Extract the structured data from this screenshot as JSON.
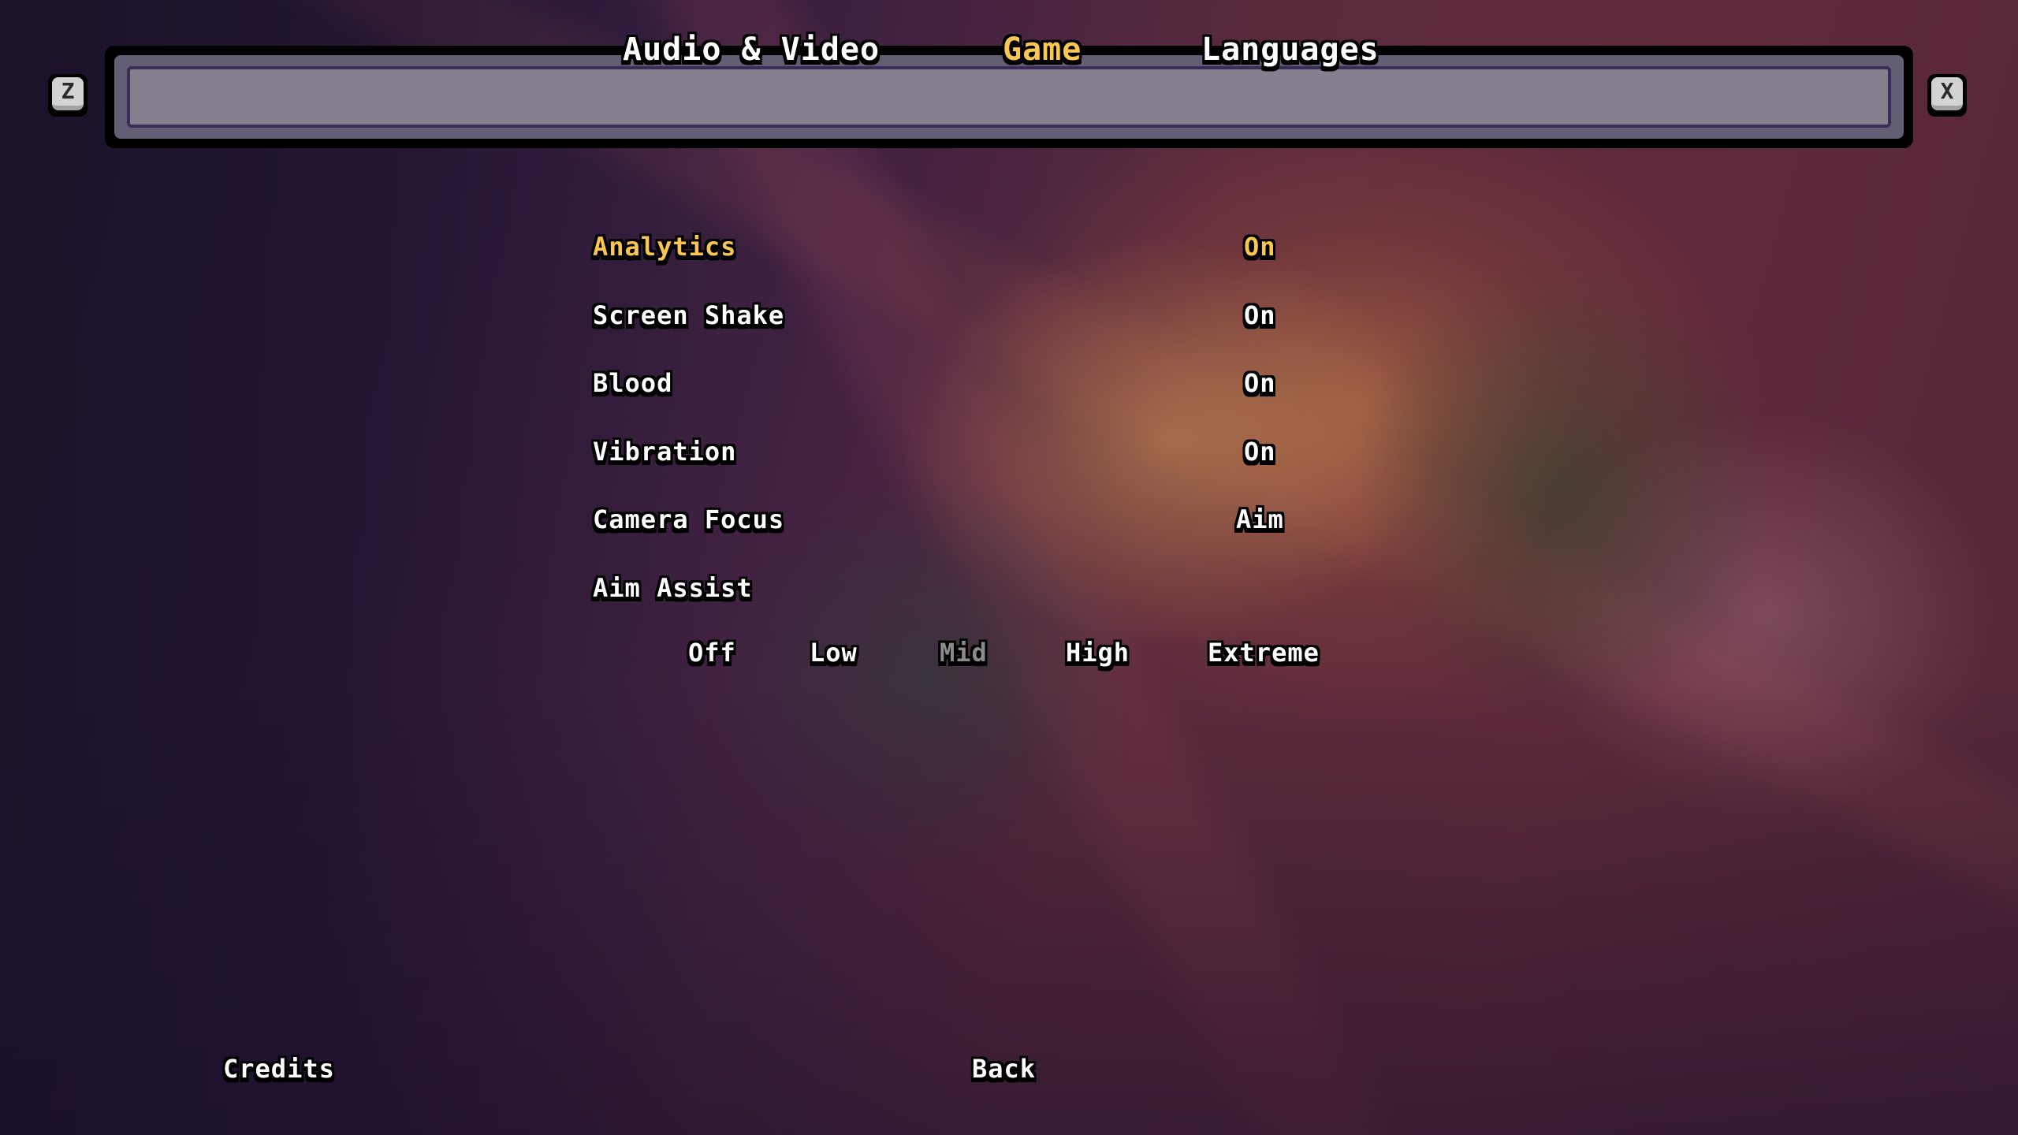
{
  "tabs": [
    {
      "label": "Audio & Video",
      "selected": false
    },
    {
      "label": "Game",
      "selected": true
    },
    {
      "label": "Languages",
      "selected": false
    }
  ],
  "keys": {
    "prev_tab": {
      "glyph": "Z",
      "icon": "keycap-z-icon"
    },
    "next_tab": {
      "glyph": "X",
      "icon": "keycap-x-icon"
    }
  },
  "settings": [
    {
      "label": "Analytics",
      "value": "On",
      "highlighted": true
    },
    {
      "label": "Screen Shake",
      "value": "On",
      "highlighted": false
    },
    {
      "label": "Blood",
      "value": "On",
      "highlighted": false
    },
    {
      "label": "Vibration",
      "value": "On",
      "highlighted": false
    },
    {
      "label": "Camera Focus",
      "value": "Aim",
      "highlighted": false
    },
    {
      "label": "Aim Assist",
      "value": "Mid",
      "highlighted": false
    }
  ],
  "aim_assist": {
    "options": [
      "Off",
      "Low",
      "Mid",
      "High",
      "Extreme"
    ],
    "selected": "Mid"
  },
  "footer": {
    "credits": "Credits",
    "back": "Back"
  },
  "colors": {
    "highlight": "#f8c651",
    "text": "#ffffff",
    "selected_option": "#8b8b8b",
    "tabbar_inner": "#857f8e",
    "tabbar_outer": "#625e74",
    "tabbar_line": "#3b2d57"
  }
}
